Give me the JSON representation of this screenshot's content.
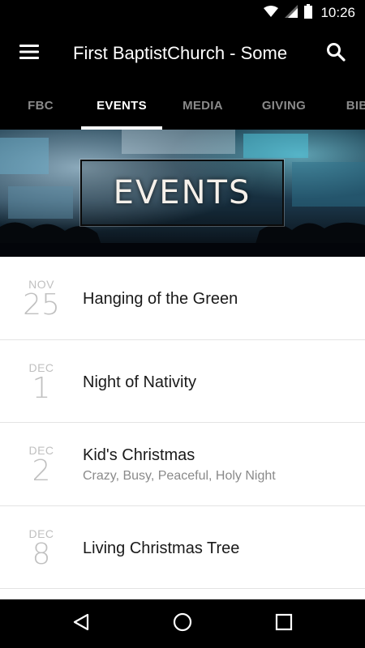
{
  "status_bar": {
    "time": "10:26"
  },
  "app_bar": {
    "title": "First BaptistChurch - Some"
  },
  "tabs": [
    {
      "label": "FBC"
    },
    {
      "label": "EVENTS"
    },
    {
      "label": "MEDIA"
    },
    {
      "label": "GIVING"
    },
    {
      "label": "BIBLE"
    }
  ],
  "banner": {
    "text": "EVENTS"
  },
  "events": [
    {
      "month": "NOV",
      "day": "25",
      "title": "Hanging of the Green",
      "subtitle": ""
    },
    {
      "month": "DEC",
      "day": "1",
      "title": "Night of Nativity",
      "subtitle": ""
    },
    {
      "month": "DEC",
      "day": "2",
      "title": "Kid's Christmas",
      "subtitle": "Crazy, Busy, Peaceful, Holy Night"
    },
    {
      "month": "DEC",
      "day": "8",
      "title": "Living Christmas Tree",
      "subtitle": ""
    }
  ]
}
